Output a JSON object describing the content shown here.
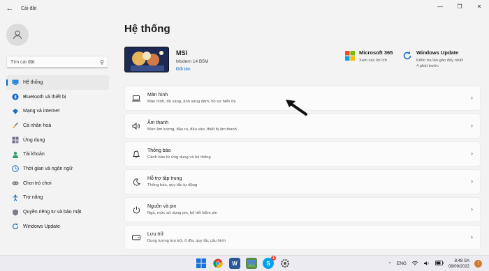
{
  "app": {
    "title": "Cài đặt"
  },
  "search": {
    "placeholder": "Tìm cài đặt"
  },
  "sidebar": {
    "items": [
      {
        "label": "Hệ thống",
        "icon": "monitor-icon",
        "active": true
      },
      {
        "label": "Bluetooth và thiết bị",
        "icon": "bluetooth-icon"
      },
      {
        "label": "Mạng và internet",
        "icon": "wifi-icon"
      },
      {
        "label": "Cá nhân hoá",
        "icon": "brush-icon"
      },
      {
        "label": "Ứng dụng",
        "icon": "apps-icon"
      },
      {
        "label": "Tài khoản",
        "icon": "person-icon"
      },
      {
        "label": "Thời gian và ngôn ngữ",
        "icon": "globe-clock-icon"
      },
      {
        "label": "Chơi trò chơi",
        "icon": "gamepad-icon"
      },
      {
        "label": "Trợ năng",
        "icon": "accessibility-icon"
      },
      {
        "label": "Quyền riêng tư và bảo mật",
        "icon": "shield-icon"
      },
      {
        "label": "Windows Update",
        "icon": "refresh-icon"
      }
    ]
  },
  "main": {
    "title": "Hệ thống",
    "device": {
      "name": "MSI",
      "model": "Modern 14 B5M",
      "rename": "Đổi tên"
    },
    "quick": [
      {
        "title": "Microsoft 365",
        "sub1": "Xem các lợi ích",
        "sub2": "",
        "icon": "microsoft-logo-icon"
      },
      {
        "title": "Windows Update",
        "sub1": "Kiểm tra lần gần đây nhất:",
        "sub2": "4 phút trước",
        "icon": "update-icon"
      }
    ],
    "cards": [
      {
        "title": "Màn hình",
        "sub": "Màn hình, độ sáng, ánh sáng đêm, hồ sơ hiển thị",
        "icon": "laptop-icon"
      },
      {
        "title": "Âm thanh",
        "sub": "Mức âm lượng, đầu ra, đầu vào, thiết bị âm thanh",
        "icon": "speaker-icon"
      },
      {
        "title": "Thông báo",
        "sub": "Cảnh báo từ ứng dụng và hệ thống",
        "icon": "bell-icon"
      },
      {
        "title": "Hỗ trợ tập trung",
        "sub": "Thông báo, quy tắc tự động",
        "icon": "moon-icon"
      },
      {
        "title": "Nguồn và pin",
        "sub": "Ngủ, mức sử dụng pin, bộ tiết kiệm pin",
        "icon": "power-icon"
      },
      {
        "title": "Lưu trữ",
        "sub": "Dung lượng lưu trữ, ổ đĩa, quy tắc cấu hình",
        "icon": "storage-icon"
      }
    ]
  },
  "taskbar": {
    "apps": [
      "windows-start-icon",
      "chrome-icon",
      "word-icon",
      "photos-icon",
      "skype-icon",
      "settings-gear-icon"
    ],
    "skype_badge": "1",
    "language": "ENG",
    "time": "8:48 SA",
    "date": "08/09/2022",
    "notification": "!"
  },
  "colors": {
    "accent": "#0067c0",
    "background": "#f3f3f3",
    "card": "#fbfbfb"
  }
}
